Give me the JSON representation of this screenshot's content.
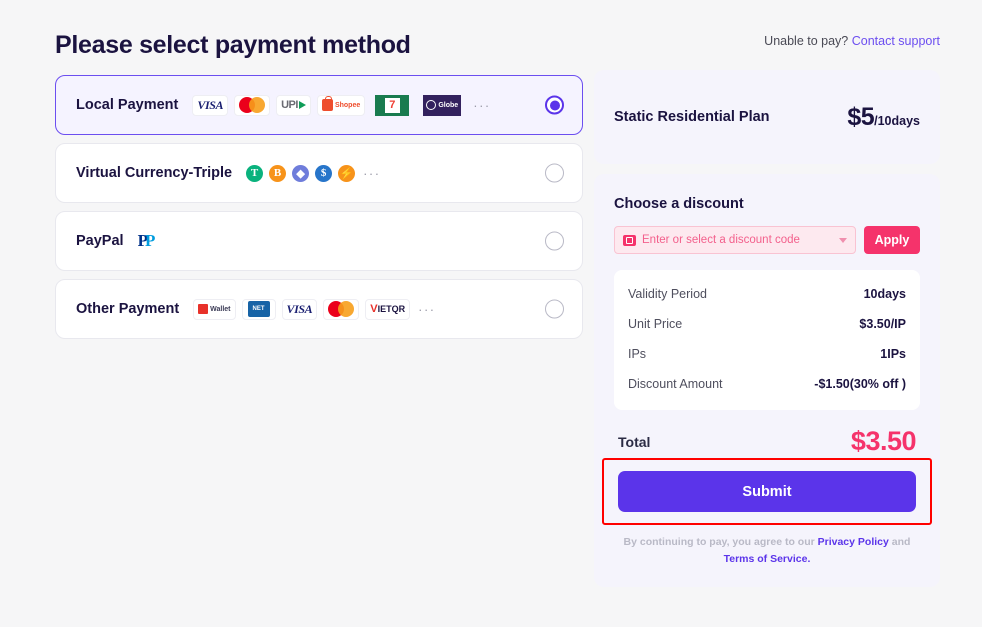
{
  "header": {
    "title": "Please select payment method",
    "support_prefix": "Unable to pay?",
    "support_link": "Contact support"
  },
  "payment_methods": [
    {
      "label": "Local Payment",
      "selected": true,
      "brands": [
        "visa",
        "mastercard",
        "upi",
        "shopee",
        "7-eleven",
        "globe"
      ],
      "overflow": "···"
    },
    {
      "label": "Virtual Currency-Triple",
      "selected": false,
      "brands": [
        "tether",
        "bitcoin",
        "ethereum",
        "usdc",
        "bnb"
      ],
      "overflow": "···"
    },
    {
      "label": "PayPal",
      "selected": false,
      "brands": [
        "paypal"
      ],
      "overflow": ""
    },
    {
      "label": "Other Payment",
      "selected": false,
      "brands": [
        "wallet",
        "netbank",
        "visa",
        "mastercard",
        "vietqr"
      ],
      "overflow": "···"
    }
  ],
  "plan": {
    "name": "Static Residential Plan",
    "price_amount": "$5",
    "price_period": "/10days"
  },
  "discount": {
    "section_title": "Choose a discount",
    "placeholder": "Enter or select a discount code",
    "value": "",
    "apply_label": "Apply"
  },
  "order_details": [
    {
      "key": "Validity Period",
      "value": "10days"
    },
    {
      "key": "Unit Price",
      "value": "$3.50/IP"
    },
    {
      "key": "IPs",
      "value": "1IPs"
    },
    {
      "key": "Discount Amount",
      "value": "-$1.50(30% off )"
    }
  ],
  "total": {
    "label": "Total",
    "value": "$3.50"
  },
  "submit": {
    "label": "Submit"
  },
  "terms": {
    "prefix": "By continuing to pay, you agree to our",
    "privacy_link": "Privacy Policy",
    "conjunction": "and",
    "tos_link": "Terms of Service."
  },
  "colors": {
    "accent_purple": "#5b34ea",
    "accent_pink": "#f5336b",
    "page_bg": "#f6f6f7",
    "card_bg": "#f5f4fc",
    "annotation_red": "#ff0000"
  }
}
